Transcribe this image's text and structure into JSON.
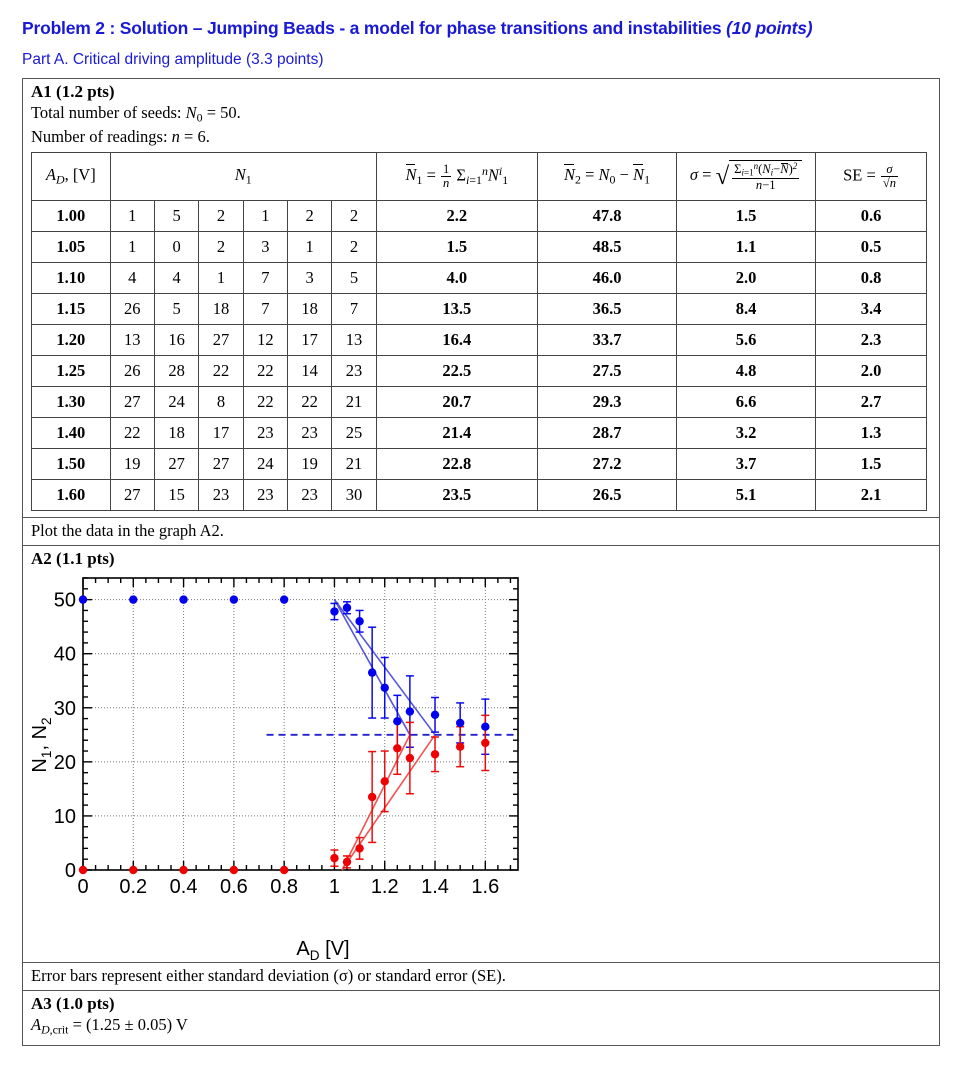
{
  "header": {
    "problem_title": "Problem 2 : Solution – Jumping Beads - a model for phase transitions and instabilities",
    "problem_points": "(10 points)",
    "part_title": "Part A. Critical driving amplitude (3.3 points)"
  },
  "a1": {
    "label": "A1 (1.2 pts)",
    "total_seeds_line": "Total number of seeds:",
    "total_seeds_value": "N₀ = 50.",
    "readings_line": "Number of readings:",
    "readings_value": "n = 6.",
    "plot_note": "Plot the data in the graph A2.",
    "columns": {
      "amplitude": "A_D, [V]",
      "raw": "N₁",
      "mean1": "N̄₁ = (1/n) Σⁿᵢ₌₁ N₁ⁱ",
      "mean2": "N̄₂ = N₀ − N̄₁",
      "sigma": "σ = sqrt( Σⁿᵢ₌₁ (Nᵢ − N̄)² / (n−1) )",
      "se": "SE = σ / √n"
    },
    "rows": [
      {
        "ad": "1.00",
        "raw": [
          "1",
          "5",
          "2",
          "1",
          "2",
          "2"
        ],
        "mean1": "2.2",
        "mean2": "47.8",
        "sigma": "1.5",
        "se": "0.6"
      },
      {
        "ad": "1.05",
        "raw": [
          "1",
          "0",
          "2",
          "3",
          "1",
          "2"
        ],
        "mean1": "1.5",
        "mean2": "48.5",
        "sigma": "1.1",
        "se": "0.5"
      },
      {
        "ad": "1.10",
        "raw": [
          "4",
          "4",
          "1",
          "7",
          "3",
          "5"
        ],
        "mean1": "4.0",
        "mean2": "46.0",
        "sigma": "2.0",
        "se": "0.8"
      },
      {
        "ad": "1.15",
        "raw": [
          "26",
          "5",
          "18",
          "7",
          "18",
          "7"
        ],
        "mean1": "13.5",
        "mean2": "36.5",
        "sigma": "8.4",
        "se": "3.4"
      },
      {
        "ad": "1.20",
        "raw": [
          "13",
          "16",
          "27",
          "12",
          "17",
          "13"
        ],
        "mean1": "16.4",
        "mean2": "33.7",
        "sigma": "5.6",
        "se": "2.3"
      },
      {
        "ad": "1.25",
        "raw": [
          "26",
          "28",
          "22",
          "22",
          "14",
          "23"
        ],
        "mean1": "22.5",
        "mean2": "27.5",
        "sigma": "4.8",
        "se": "2.0"
      },
      {
        "ad": "1.30",
        "raw": [
          "27",
          "24",
          "8",
          "22",
          "22",
          "21"
        ],
        "mean1": "20.7",
        "mean2": "29.3",
        "sigma": "6.6",
        "se": "2.7"
      },
      {
        "ad": "1.40",
        "raw": [
          "22",
          "18",
          "17",
          "23",
          "23",
          "25"
        ],
        "mean1": "21.4",
        "mean2": "28.7",
        "sigma": "3.2",
        "se": "1.3"
      },
      {
        "ad": "1.50",
        "raw": [
          "19",
          "27",
          "27",
          "24",
          "19",
          "21"
        ],
        "mean1": "22.8",
        "mean2": "27.2",
        "sigma": "3.7",
        "se": "1.5"
      },
      {
        "ad": "1.60",
        "raw": [
          "27",
          "15",
          "23",
          "23",
          "23",
          "30"
        ],
        "mean1": "23.5",
        "mean2": "26.5",
        "sigma": "5.1",
        "se": "2.1"
      }
    ]
  },
  "a2": {
    "label": "A2 (1.1 pts)",
    "caption": "Error bars represent either standard deviation (σ) or standard error (SE)."
  },
  "a3": {
    "label": "A3 (1.0 pts)",
    "result_lhs": "A_D,crit",
    "result_rhs": "= (1.25 ± 0.05) V"
  },
  "chart_data": {
    "type": "scatter",
    "title": "",
    "xlabel": "A_D [V]",
    "ylabel": "N₁, N₂",
    "xlim": [
      0,
      1.73
    ],
    "ylim": [
      0,
      54
    ],
    "xticks": [
      0,
      0.2,
      0.4,
      0.6,
      0.8,
      1,
      1.2,
      1.4,
      1.6
    ],
    "xticklabels": [
      "0",
      "0.2",
      "0.4",
      "0.6",
      "0.8",
      "1",
      "1.2",
      "1.4",
      "1.6"
    ],
    "yticks": [
      0,
      10,
      20,
      30,
      40,
      50
    ],
    "yticklabels": [
      "0",
      "10",
      "20",
      "30",
      "40",
      "50"
    ],
    "grid": true,
    "legend": "none",
    "colors": {
      "series1": "#0000ee",
      "series2": "#ee0000",
      "fit_blue": "#5555dd",
      "fit_red": "#ee5555",
      "half_line": "#2222cc"
    },
    "series": [
      {
        "name": "N2",
        "color": "#0000ee",
        "x": [
          0,
          0.2,
          0.4,
          0.6,
          0.8,
          1.0,
          1.05,
          1.1,
          1.15,
          1.2,
          1.25,
          1.3,
          1.4,
          1.5,
          1.6
        ],
        "y": [
          50,
          50,
          50,
          50,
          50,
          47.8,
          48.5,
          46.0,
          36.5,
          33.7,
          27.5,
          29.3,
          28.7,
          27.2,
          26.5
        ],
        "yerr": [
          0,
          0,
          0,
          0,
          0,
          1.5,
          1.1,
          2.0,
          8.4,
          5.6,
          4.8,
          6.6,
          3.2,
          3.7,
          5.1
        ]
      },
      {
        "name": "N1",
        "color": "#ee0000",
        "x": [
          0,
          0.2,
          0.4,
          0.6,
          0.8,
          1.0,
          1.05,
          1.1,
          1.15,
          1.2,
          1.25,
          1.3,
          1.4,
          1.5,
          1.6
        ],
        "y": [
          0,
          0,
          0,
          0,
          0,
          2.2,
          1.5,
          4.0,
          13.5,
          16.4,
          22.5,
          20.7,
          21.4,
          22.8,
          23.5
        ],
        "yerr": [
          0,
          0,
          0,
          0,
          0,
          1.5,
          1.1,
          2.0,
          8.4,
          5.6,
          4.8,
          6.6,
          3.2,
          3.7,
          5.1
        ]
      }
    ],
    "fit_lines": [
      {
        "name": "blue-fit-1",
        "color": "#5555dd",
        "x1": 1.0,
        "y1": 50.0,
        "x2": 1.3,
        "y2": 25.0
      },
      {
        "name": "blue-fit-2",
        "color": "#5555dd",
        "x1": 1.0,
        "y1": 50.0,
        "x2": 1.4,
        "y2": 25.0
      },
      {
        "name": "red-fit-1",
        "color": "#ee5555",
        "x1": 1.03,
        "y1": 0.0,
        "x2": 1.3,
        "y2": 25.0
      },
      {
        "name": "red-fit-2",
        "color": "#ee5555",
        "x1": 1.03,
        "y1": 0.0,
        "x2": 1.4,
        "y2": 25.0
      }
    ],
    "half_line": {
      "name": "N0/2 level",
      "y": 25,
      "x_start": 0.73,
      "x_end": 1.73,
      "style": "dashed",
      "color": "#2222cc"
    },
    "annotations": []
  }
}
